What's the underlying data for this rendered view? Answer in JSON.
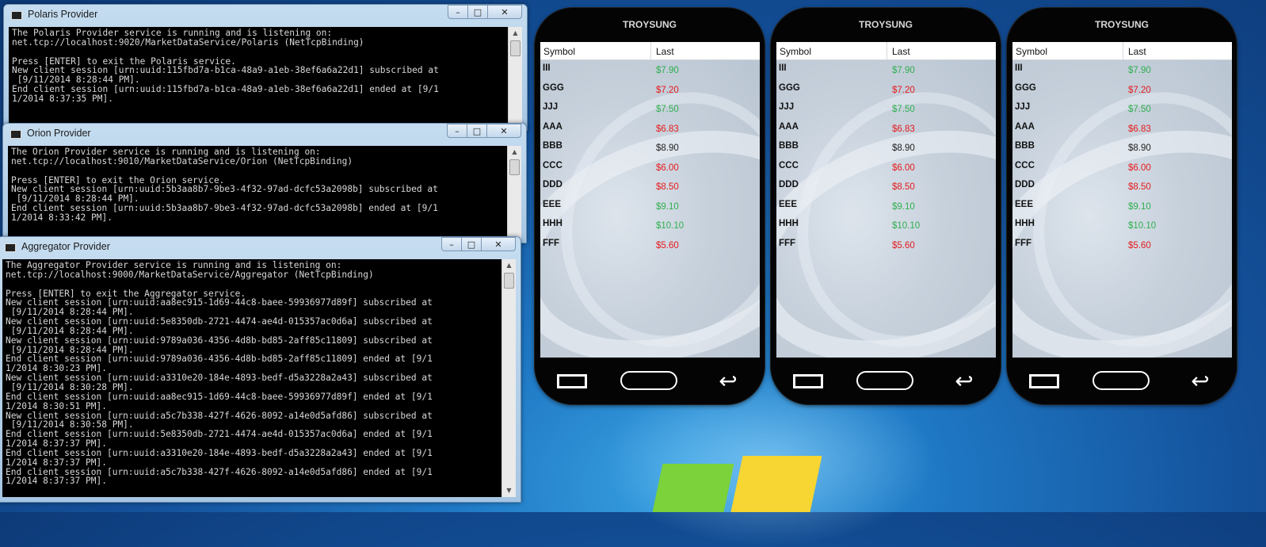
{
  "windows": [
    {
      "title": "Polaris Provider",
      "lines": [
        "The Polaris Provider service is running and is listening on:",
        "net.tcp://localhost:9020/MarketDataService/Polaris (NetTcpBinding)",
        "",
        "Press [ENTER] to exit the Polaris service.",
        "New client session [urn:uuid:115fbd7a-b1ca-48a9-a1eb-38ef6a6a22d1] subscribed at",
        " [9/11/2014 8:28:44 PM].",
        "End client session [urn:uuid:115fbd7a-b1ca-48a9-a1eb-38ef6a6a22d1] ended at [9/1",
        "1/2014 8:37:35 PM]."
      ]
    },
    {
      "title": "Orion Provider",
      "lines": [
        "The Orion Provider service is running and is listening on:",
        "net.tcp://localhost:9010/MarketDataService/Orion (NetTcpBinding)",
        "",
        "Press [ENTER] to exit the Orion service.",
        "New client session [urn:uuid:5b3aa8b7-9be3-4f32-97ad-dcfc53a2098b] subscribed at",
        " [9/11/2014 8:28:44 PM].",
        "End client session [urn:uuid:5b3aa8b7-9be3-4f32-97ad-dcfc53a2098b] ended at [9/1",
        "1/2014 8:33:42 PM]."
      ]
    },
    {
      "title": "Aggregator Provider",
      "lines": [
        "The Aggregator Provider service is running and is listening on:",
        "net.tcp://localhost:9000/MarketDataService/Aggregator (NetTcpBinding)",
        "",
        "Press [ENTER] to exit the Aggregator service.",
        "New client session [urn:uuid:aa8ec915-1d69-44c8-baee-59936977d89f] subscribed at",
        " [9/11/2014 8:28:44 PM].",
        "New client session [urn:uuid:5e8350db-2721-4474-ae4d-015357ac0d6a] subscribed at",
        " [9/11/2014 8:28:44 PM].",
        "New client session [urn:uuid:9789a036-4356-4d8b-bd85-2aff85c11809] subscribed at",
        " [9/11/2014 8:28:44 PM].",
        "End client session [urn:uuid:9789a036-4356-4d8b-bd85-2aff85c11809] ended at [9/1",
        "1/2014 8:30:23 PM].",
        "New client session [urn:uuid:a3310e20-184e-4893-bedf-d5a3228a2a43] subscribed at",
        " [9/11/2014 8:30:28 PM].",
        "End client session [urn:uuid:aa8ec915-1d69-44c8-baee-59936977d89f] ended at [9/1",
        "1/2014 8:30:51 PM].",
        "New client session [urn:uuid:a5c7b338-427f-4626-8092-a14e0d5afd86] subscribed at",
        " [9/11/2014 8:30:58 PM].",
        "End client session [urn:uuid:5e8350db-2721-4474-ae4d-015357ac0d6a] ended at [9/1",
        "1/2014 8:37:37 PM].",
        "End client session [urn:uuid:a3310e20-184e-4893-bedf-d5a3228a2a43] ended at [9/1",
        "1/2014 8:37:37 PM].",
        "End client session [urn:uuid:a5c7b338-427f-4626-8092-a14e0d5afd86] ended at [9/1",
        "1/2014 8:37:37 PM]."
      ]
    }
  ],
  "window_buttons": {
    "minimize": "–",
    "maximize": "□",
    "close": "✕"
  },
  "colors": {
    "up": "#2fae4e",
    "down": "#e5191c",
    "flat": "#222222"
  },
  "phones": [
    {
      "brand": "TROYSUNG",
      "header": {
        "symbol": "Symbol",
        "last": "Last"
      },
      "rows": [
        {
          "symbol": "III",
          "last": "$7.90",
          "trend": "up"
        },
        {
          "symbol": "GGG",
          "last": "$7.20",
          "trend": "down"
        },
        {
          "symbol": "JJJ",
          "last": "$7.50",
          "trend": "up"
        },
        {
          "symbol": "AAA",
          "last": "$6.83",
          "trend": "down"
        },
        {
          "symbol": "BBB",
          "last": "$8.90",
          "trend": "flat"
        },
        {
          "symbol": "CCC",
          "last": "$6.00",
          "trend": "down"
        },
        {
          "symbol": "DDD",
          "last": "$8.50",
          "trend": "down"
        },
        {
          "symbol": "EEE",
          "last": "$9.10",
          "trend": "up"
        },
        {
          "symbol": "HHH",
          "last": "$10.10",
          "trend": "up"
        },
        {
          "symbol": "FFF",
          "last": "$5.60",
          "trend": "down"
        }
      ],
      "nav_icons": [
        "back-button-icon",
        "home-button-icon",
        "return-arrow-icon"
      ]
    },
    {
      "brand": "TROYSUNG",
      "header": {
        "symbol": "Symbol",
        "last": "Last"
      },
      "rows": [
        {
          "symbol": "III",
          "last": "$7.90",
          "trend": "up"
        },
        {
          "symbol": "GGG",
          "last": "$7.20",
          "trend": "down"
        },
        {
          "symbol": "JJJ",
          "last": "$7.50",
          "trend": "up"
        },
        {
          "symbol": "AAA",
          "last": "$6.83",
          "trend": "down"
        },
        {
          "symbol": "BBB",
          "last": "$8.90",
          "trend": "flat"
        },
        {
          "symbol": "CCC",
          "last": "$6.00",
          "trend": "down"
        },
        {
          "symbol": "DDD",
          "last": "$8.50",
          "trend": "down"
        },
        {
          "symbol": "EEE",
          "last": "$9.10",
          "trend": "up"
        },
        {
          "symbol": "HHH",
          "last": "$10.10",
          "trend": "up"
        },
        {
          "symbol": "FFF",
          "last": "$5.60",
          "trend": "down"
        }
      ],
      "nav_icons": [
        "back-button-icon",
        "home-button-icon",
        "return-arrow-icon"
      ]
    },
    {
      "brand": "TROYSUNG",
      "header": {
        "symbol": "Symbol",
        "last": "Last"
      },
      "rows": [
        {
          "symbol": "III",
          "last": "$7.90",
          "trend": "up"
        },
        {
          "symbol": "GGG",
          "last": "$7.20",
          "trend": "down"
        },
        {
          "symbol": "JJJ",
          "last": "$7.50",
          "trend": "up"
        },
        {
          "symbol": "AAA",
          "last": "$6.83",
          "trend": "down"
        },
        {
          "symbol": "BBB",
          "last": "$8.90",
          "trend": "flat"
        },
        {
          "symbol": "CCC",
          "last": "$6.00",
          "trend": "down"
        },
        {
          "symbol": "DDD",
          "last": "$8.50",
          "trend": "down"
        },
        {
          "symbol": "EEE",
          "last": "$9.10",
          "trend": "up"
        },
        {
          "symbol": "HHH",
          "last": "$10.10",
          "trend": "up"
        },
        {
          "symbol": "FFF",
          "last": "$5.60",
          "trend": "down"
        }
      ],
      "nav_icons": [
        "back-button-icon",
        "home-button-icon",
        "return-arrow-icon"
      ]
    }
  ]
}
